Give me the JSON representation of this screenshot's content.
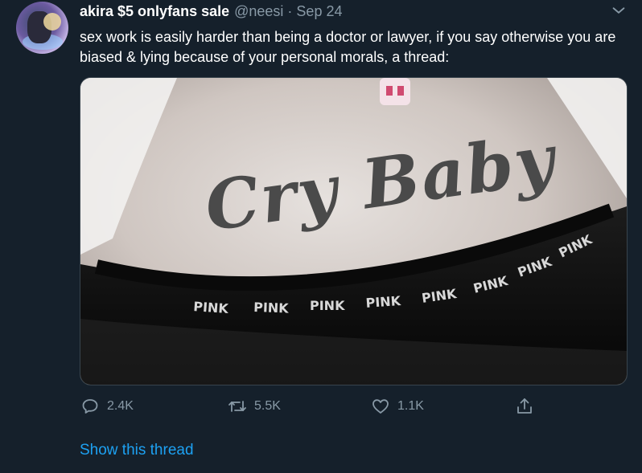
{
  "tweet": {
    "display_name": "akira $5 onlyfans sale",
    "handle": "@neesi",
    "separator": "·",
    "date": "Sep 24",
    "text": "sex work is easily harder than being a doctor or lawyer, if you say otherwise you are biased & lying because of your personal morals, a thread:",
    "media": {
      "tattoo_text": "Cry Baby",
      "waistband_text": "PINK"
    }
  },
  "actions": {
    "reply_count": "2.4K",
    "retweet_count": "5.5K",
    "like_count": "1.1K",
    "reply_icon": "reply-icon",
    "retweet_icon": "retweet-icon",
    "like_icon": "heart-icon",
    "share_icon": "share-icon"
  },
  "show_thread_label": "Show this thread",
  "colors": {
    "background": "#15202b",
    "secondary_text": "#8899a6",
    "link": "#1da1f2"
  }
}
